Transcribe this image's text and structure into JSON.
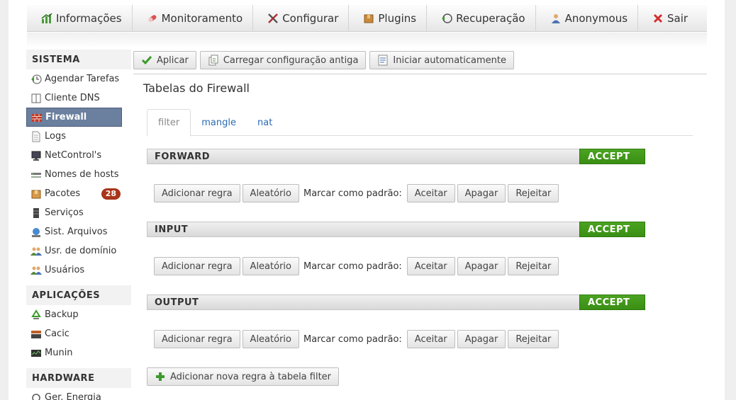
{
  "topnav": [
    {
      "label": "Informações",
      "icon": "info-chart-icon"
    },
    {
      "label": "Monitoramento",
      "icon": "pill-icon"
    },
    {
      "label": "Configurar",
      "icon": "tools-icon"
    },
    {
      "label": "Plugins",
      "icon": "box-icon"
    },
    {
      "label": "Recuperação",
      "icon": "restore-icon"
    },
    {
      "label": "Anonymous",
      "icon": "user-icon"
    },
    {
      "label": "Sair",
      "icon": "close-icon"
    }
  ],
  "sidebar": {
    "sistema": {
      "title": "SISTEMA",
      "items": [
        {
          "label": "Agendar Tarefas"
        },
        {
          "label": "Cliente DNS"
        },
        {
          "label": "Firewall"
        },
        {
          "label": "Logs"
        },
        {
          "label": "NetControl's"
        },
        {
          "label": "Nomes de hosts"
        },
        {
          "label": "Pacotes",
          "badge": "28"
        },
        {
          "label": "Serviços"
        },
        {
          "label": "Sist. Arquivos"
        },
        {
          "label": "Usr. de domínio"
        },
        {
          "label": "Usuários"
        }
      ]
    },
    "aplicacoes": {
      "title": "APLICAÇÕES",
      "items": [
        {
          "label": "Backup"
        },
        {
          "label": "Cacic"
        },
        {
          "label": "Munin"
        }
      ]
    },
    "hardware": {
      "title": "HARDWARE",
      "items": [
        {
          "label": "Ger. Energia"
        }
      ]
    }
  },
  "toolbar": {
    "apply": "Aplicar",
    "load_old": "Carregar configuração antiga",
    "autostart": "Iniciar automaticamente"
  },
  "page_title": "Tabelas do Firewall",
  "tabs": [
    "filter",
    "mangle",
    "nat"
  ],
  "chains": [
    {
      "name": "FORWARD",
      "policy": "ACCEPT"
    },
    {
      "name": "INPUT",
      "policy": "ACCEPT"
    },
    {
      "name": "OUTPUT",
      "policy": "ACCEPT"
    }
  ],
  "chain_actions": {
    "add_rule": "Adicionar regra",
    "random": "Aleatório",
    "mark_default": "Marcar como padrão:",
    "accept": "Aceitar",
    "delete": "Apagar",
    "reject": "Rejeitar"
  },
  "add_new_rule": "Adicionar nova regra à tabela filter",
  "colors": {
    "accept_green": "#3f9717",
    "active_item": "#6b7f9e",
    "badge": "#a8351a",
    "link": "#2a6bb5"
  }
}
